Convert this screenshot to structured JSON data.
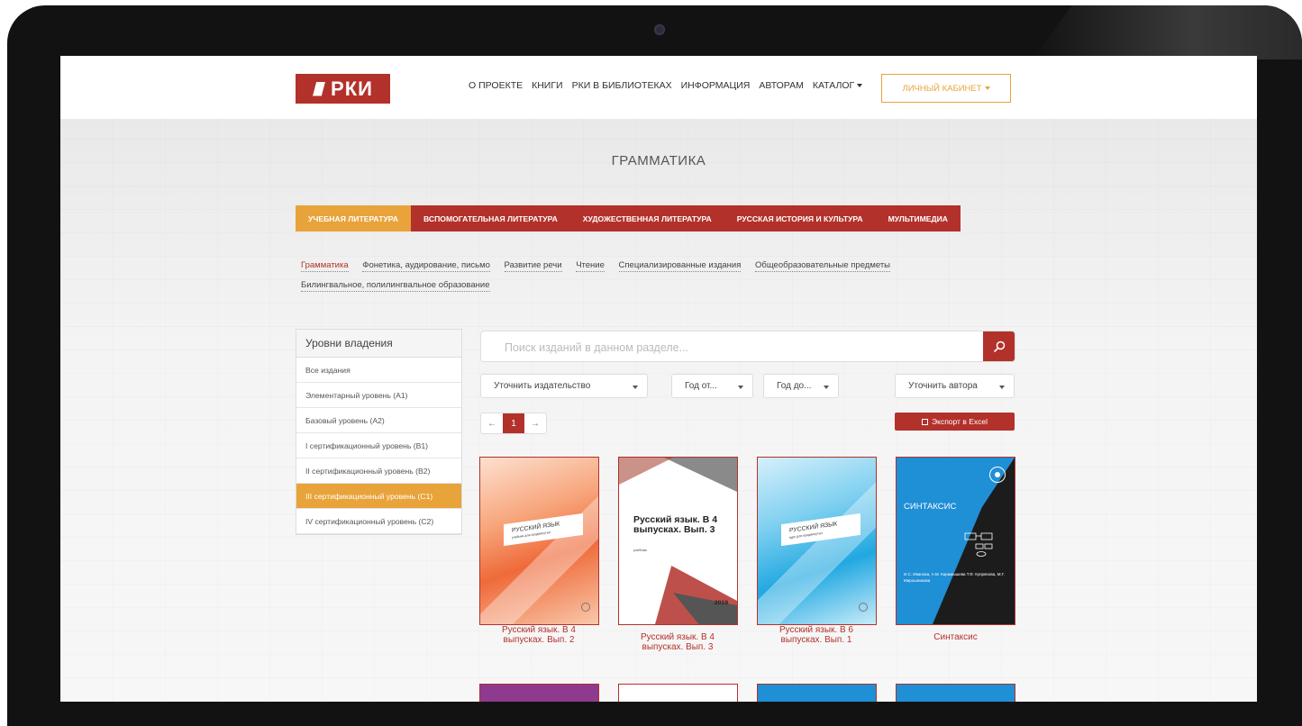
{
  "header": {
    "logo_text": "РКИ",
    "nav": [
      "О ПРОЕКТЕ",
      "КНИГИ",
      "РКИ В БИБЛИОТЕКАХ",
      "ИНФОРМАЦИЯ",
      "АВТОРАМ",
      "КАТАЛОГ"
    ],
    "cabinet_label": "ЛИЧНЫЙ КАБИНЕТ"
  },
  "page_title": "ГРАММАТИКА",
  "tabs": [
    "УЧЕБНАЯ ЛИТЕРАТУРА",
    "ВСПОМОГАТЕЛЬНАЯ ЛИТЕРАТУРА",
    "ХУДОЖЕСТВЕННАЯ ЛИТЕРАТУРА",
    "РУССКАЯ ИСТОРИЯ И КУЛЬТУРА",
    "МУЛЬТИМЕДИА"
  ],
  "subnav": [
    "Грамматика",
    "Фонетика, аудирование, письмо",
    "Развитие речи",
    "Чтение",
    "Специализированные издания",
    "Общеобразовательные предметы",
    "Билингвальное, полилингвальное образование"
  ],
  "levels": {
    "title": "Уровни владения",
    "items": [
      "Все издания",
      "Элементарный уровень (А1)",
      "Базовый уровень (А2)",
      "I сертификационный уровень (В1)",
      "II сертификационный уровень (В2)",
      "III сертификационный уровень (С1)",
      "IV сертификационный уровень (С2)"
    ]
  },
  "search": {
    "placeholder": "Поиск изданий в данном разделе..."
  },
  "filters": {
    "publisher": "Уточнить издательство",
    "year_from": "Год от...",
    "year_to": "Год до...",
    "author": "Уточнить автора"
  },
  "pager": {
    "prev": "←",
    "page": "1",
    "next": "→"
  },
  "export_label": "Экспорт в Excel",
  "books": [
    {
      "title": "Русский язык. В 4 выпусках. Вып. 2",
      "cover_title": "РУССКИЙ ЯЗЫК",
      "cover_sub": "учебник для продвинутых"
    },
    {
      "title": "Русский язык. В 4 выпусках. Вып. 3",
      "cover_title": "Русский язык. В 4 выпусках. Вып. 3",
      "cover_sub": "учебник",
      "cover_year": "2019"
    },
    {
      "title": "Русский язык. В 6 выпусках. Вып. 1",
      "cover_title": "РУССКИЙ ЯЗЫК",
      "cover_sub": "курс для продвинутых"
    },
    {
      "title": "Синтаксис",
      "cover_title": "СИНТАКСИС",
      "cover_authors": "И.С. Иванова, А.М. Карамышева Т.Ф. Купрянова, М.Г. Мирошникова"
    }
  ],
  "colors": {
    "brand_red": "#b3312b",
    "accent_orange": "#e8a33a"
  }
}
